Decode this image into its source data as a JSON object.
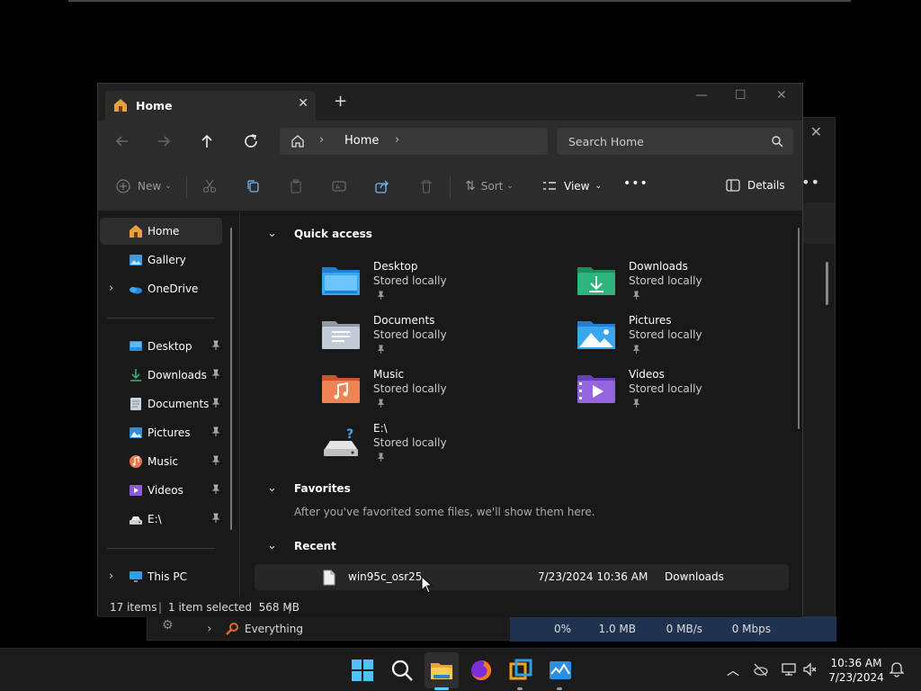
{
  "background_window": {
    "row_name": "Everything",
    "cpu": "0%",
    "memory": "1.0 MB",
    "disk": "0 MB/s",
    "network": "0 Mbps"
  },
  "explorer": {
    "tab_title": "Home",
    "address_segment": "Home",
    "search_placeholder": "Search Home",
    "toolbar": {
      "new_label": "New",
      "sort_label": "Sort",
      "view_label": "View",
      "details_label": "Details"
    },
    "sidebar": {
      "top_items": [
        {
          "label": "Home",
          "icon": "home-icon"
        },
        {
          "label": "Gallery",
          "icon": "gallery-icon"
        },
        {
          "label": "OneDrive",
          "icon": "onedrive-icon"
        }
      ],
      "pinned_items": [
        {
          "label": "Desktop",
          "icon": "desktop-folder-icon"
        },
        {
          "label": "Downloads",
          "icon": "downloads-icon"
        },
        {
          "label": "Documents",
          "icon": "documents-icon"
        },
        {
          "label": "Pictures",
          "icon": "pictures-icon"
        },
        {
          "label": "Music",
          "icon": "music-icon"
        },
        {
          "label": "Videos",
          "icon": "videos-icon"
        },
        {
          "label": "E:\\",
          "icon": "drive-icon"
        }
      ],
      "this_pc": "This PC"
    },
    "quick_access": {
      "title": "Quick access",
      "items": [
        {
          "name": "Desktop",
          "status": "Stored locally"
        },
        {
          "name": "Downloads",
          "status": "Stored locally"
        },
        {
          "name": "Documents",
          "status": "Stored locally"
        },
        {
          "name": "Pictures",
          "status": "Stored locally"
        },
        {
          "name": "Music",
          "status": "Stored locally"
        },
        {
          "name": "Videos",
          "status": "Stored locally"
        },
        {
          "name": "E:\\",
          "status": "Stored locally"
        }
      ]
    },
    "favorites": {
      "title": "Favorites",
      "empty_message": "After you've favorited some files, we'll show them here."
    },
    "recent": {
      "title": "Recent",
      "files": [
        {
          "name": "win95c_osr25",
          "date": "7/23/2024 10:36 AM",
          "location": "Downloads"
        }
      ]
    },
    "status": {
      "items": "17 items",
      "selection": "1 item selected  568 MB"
    }
  },
  "taskbar": {
    "time": "10:36 AM",
    "date": "7/23/2024"
  },
  "colors": {
    "folder_blue": "#3a9be0",
    "folder_green": "#2fae7a",
    "folder_orange": "#e8764a",
    "folder_purple": "#8b5cd6",
    "accent": "#60cdff"
  }
}
